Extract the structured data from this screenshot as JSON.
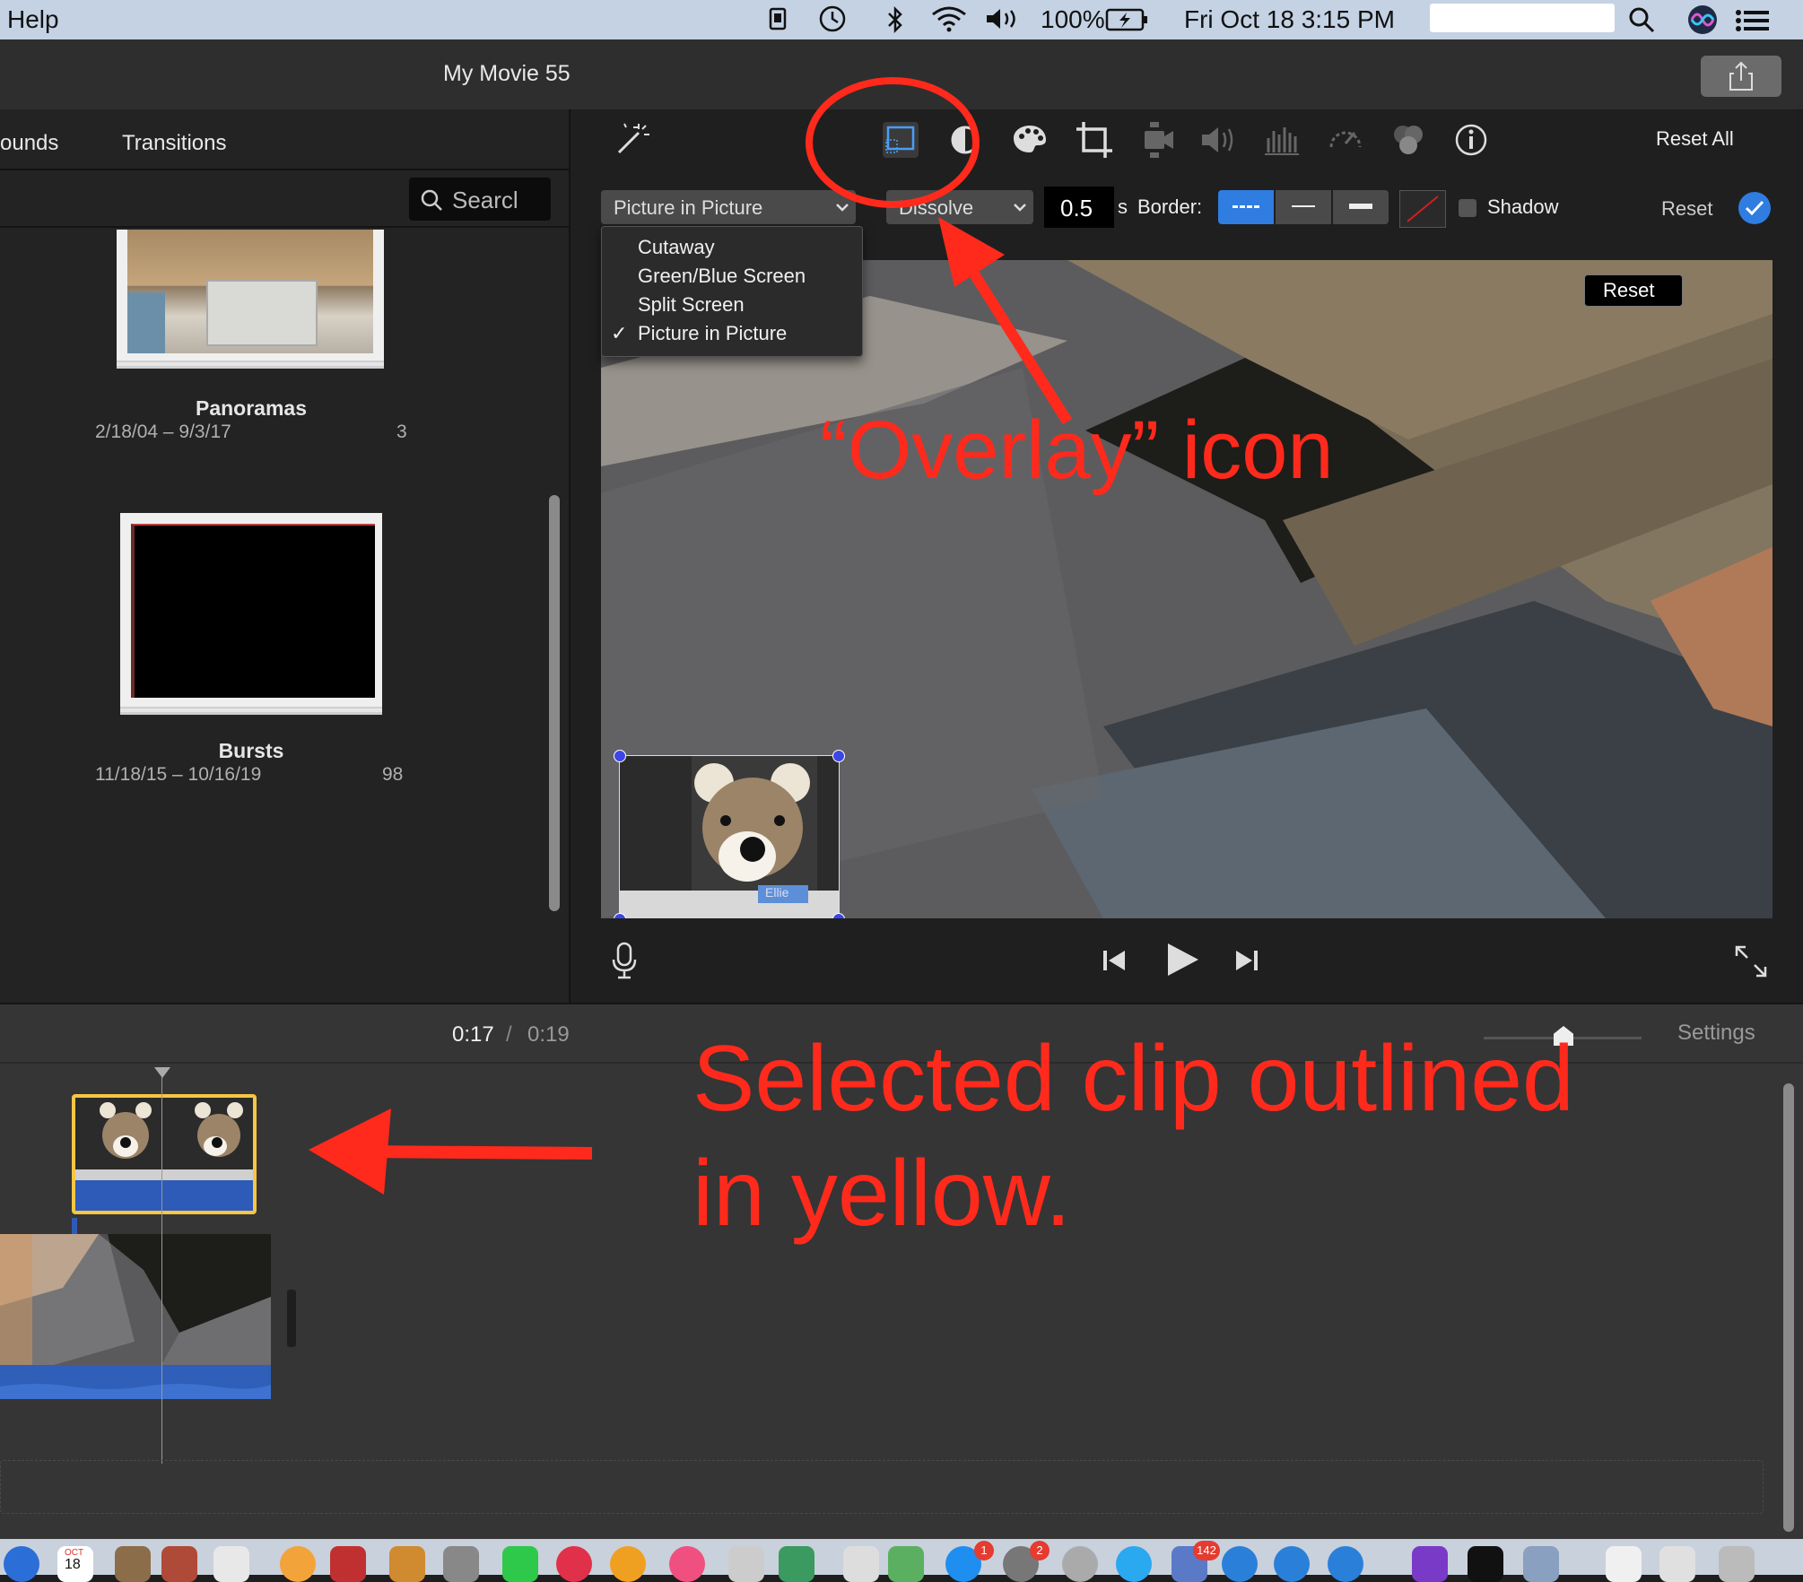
{
  "menubar": {
    "help_label": "Help",
    "battery": "100%",
    "datetime": "Fri Oct 18  3:15 PM"
  },
  "window": {
    "title": "My Movie 55"
  },
  "browser": {
    "tabs": [
      {
        "label": "ounds"
      },
      {
        "label": "Transitions"
      }
    ],
    "search_placeholder": "Searcl",
    "albums": [
      {
        "name": "Panoramas",
        "dates": "2/18/04 – 9/3/17",
        "count": "3"
      },
      {
        "name": "Bursts",
        "dates": "11/18/15 – 10/16/19",
        "count": "98"
      }
    ]
  },
  "viewer": {
    "reset_all_label": "Reset All",
    "overlay_style": {
      "selected": "Picture in Picture",
      "options": [
        "Cutaway",
        "Green/Blue Screen",
        "Split Screen",
        "Picture in Picture"
      ]
    },
    "transition": "Dissolve",
    "duration": "0.5",
    "duration_unit": "s",
    "border_label": "Border:",
    "shadow_label": "Shadow",
    "reset_label": "Reset",
    "preview_reset_label": "Reset",
    "pip_caption": "Ellie"
  },
  "annotations": {
    "overlay_icon_text": "“Overlay” icon",
    "selected_clip_line1": "Selected clip outlined",
    "selected_clip_line2": "in yellow.",
    "color": "#ff2a1c"
  },
  "timeline": {
    "current_time": "0:17",
    "separator": "/",
    "total_time": "0:19",
    "settings_label": "Settings"
  },
  "dock": {
    "calendar_month": "OCT",
    "calendar_day": "18",
    "badges": [
      "1",
      "2",
      "142"
    ]
  },
  "colors": {
    "accent": "#2f7de1",
    "selection_outline": "#f6c644",
    "annotation_red": "#ff2a1c"
  },
  "icons": [
    "magic-wand-icon",
    "overlay-icon",
    "color-balance-icon",
    "palette-icon",
    "crop-icon",
    "stabilization-icon",
    "volume-icon",
    "equalizer-icon",
    "speed-icon",
    "filter-icon",
    "info-icon",
    "microphone-icon",
    "skip-back-icon",
    "play-icon",
    "skip-forward-icon",
    "fullscreen-icon"
  ]
}
